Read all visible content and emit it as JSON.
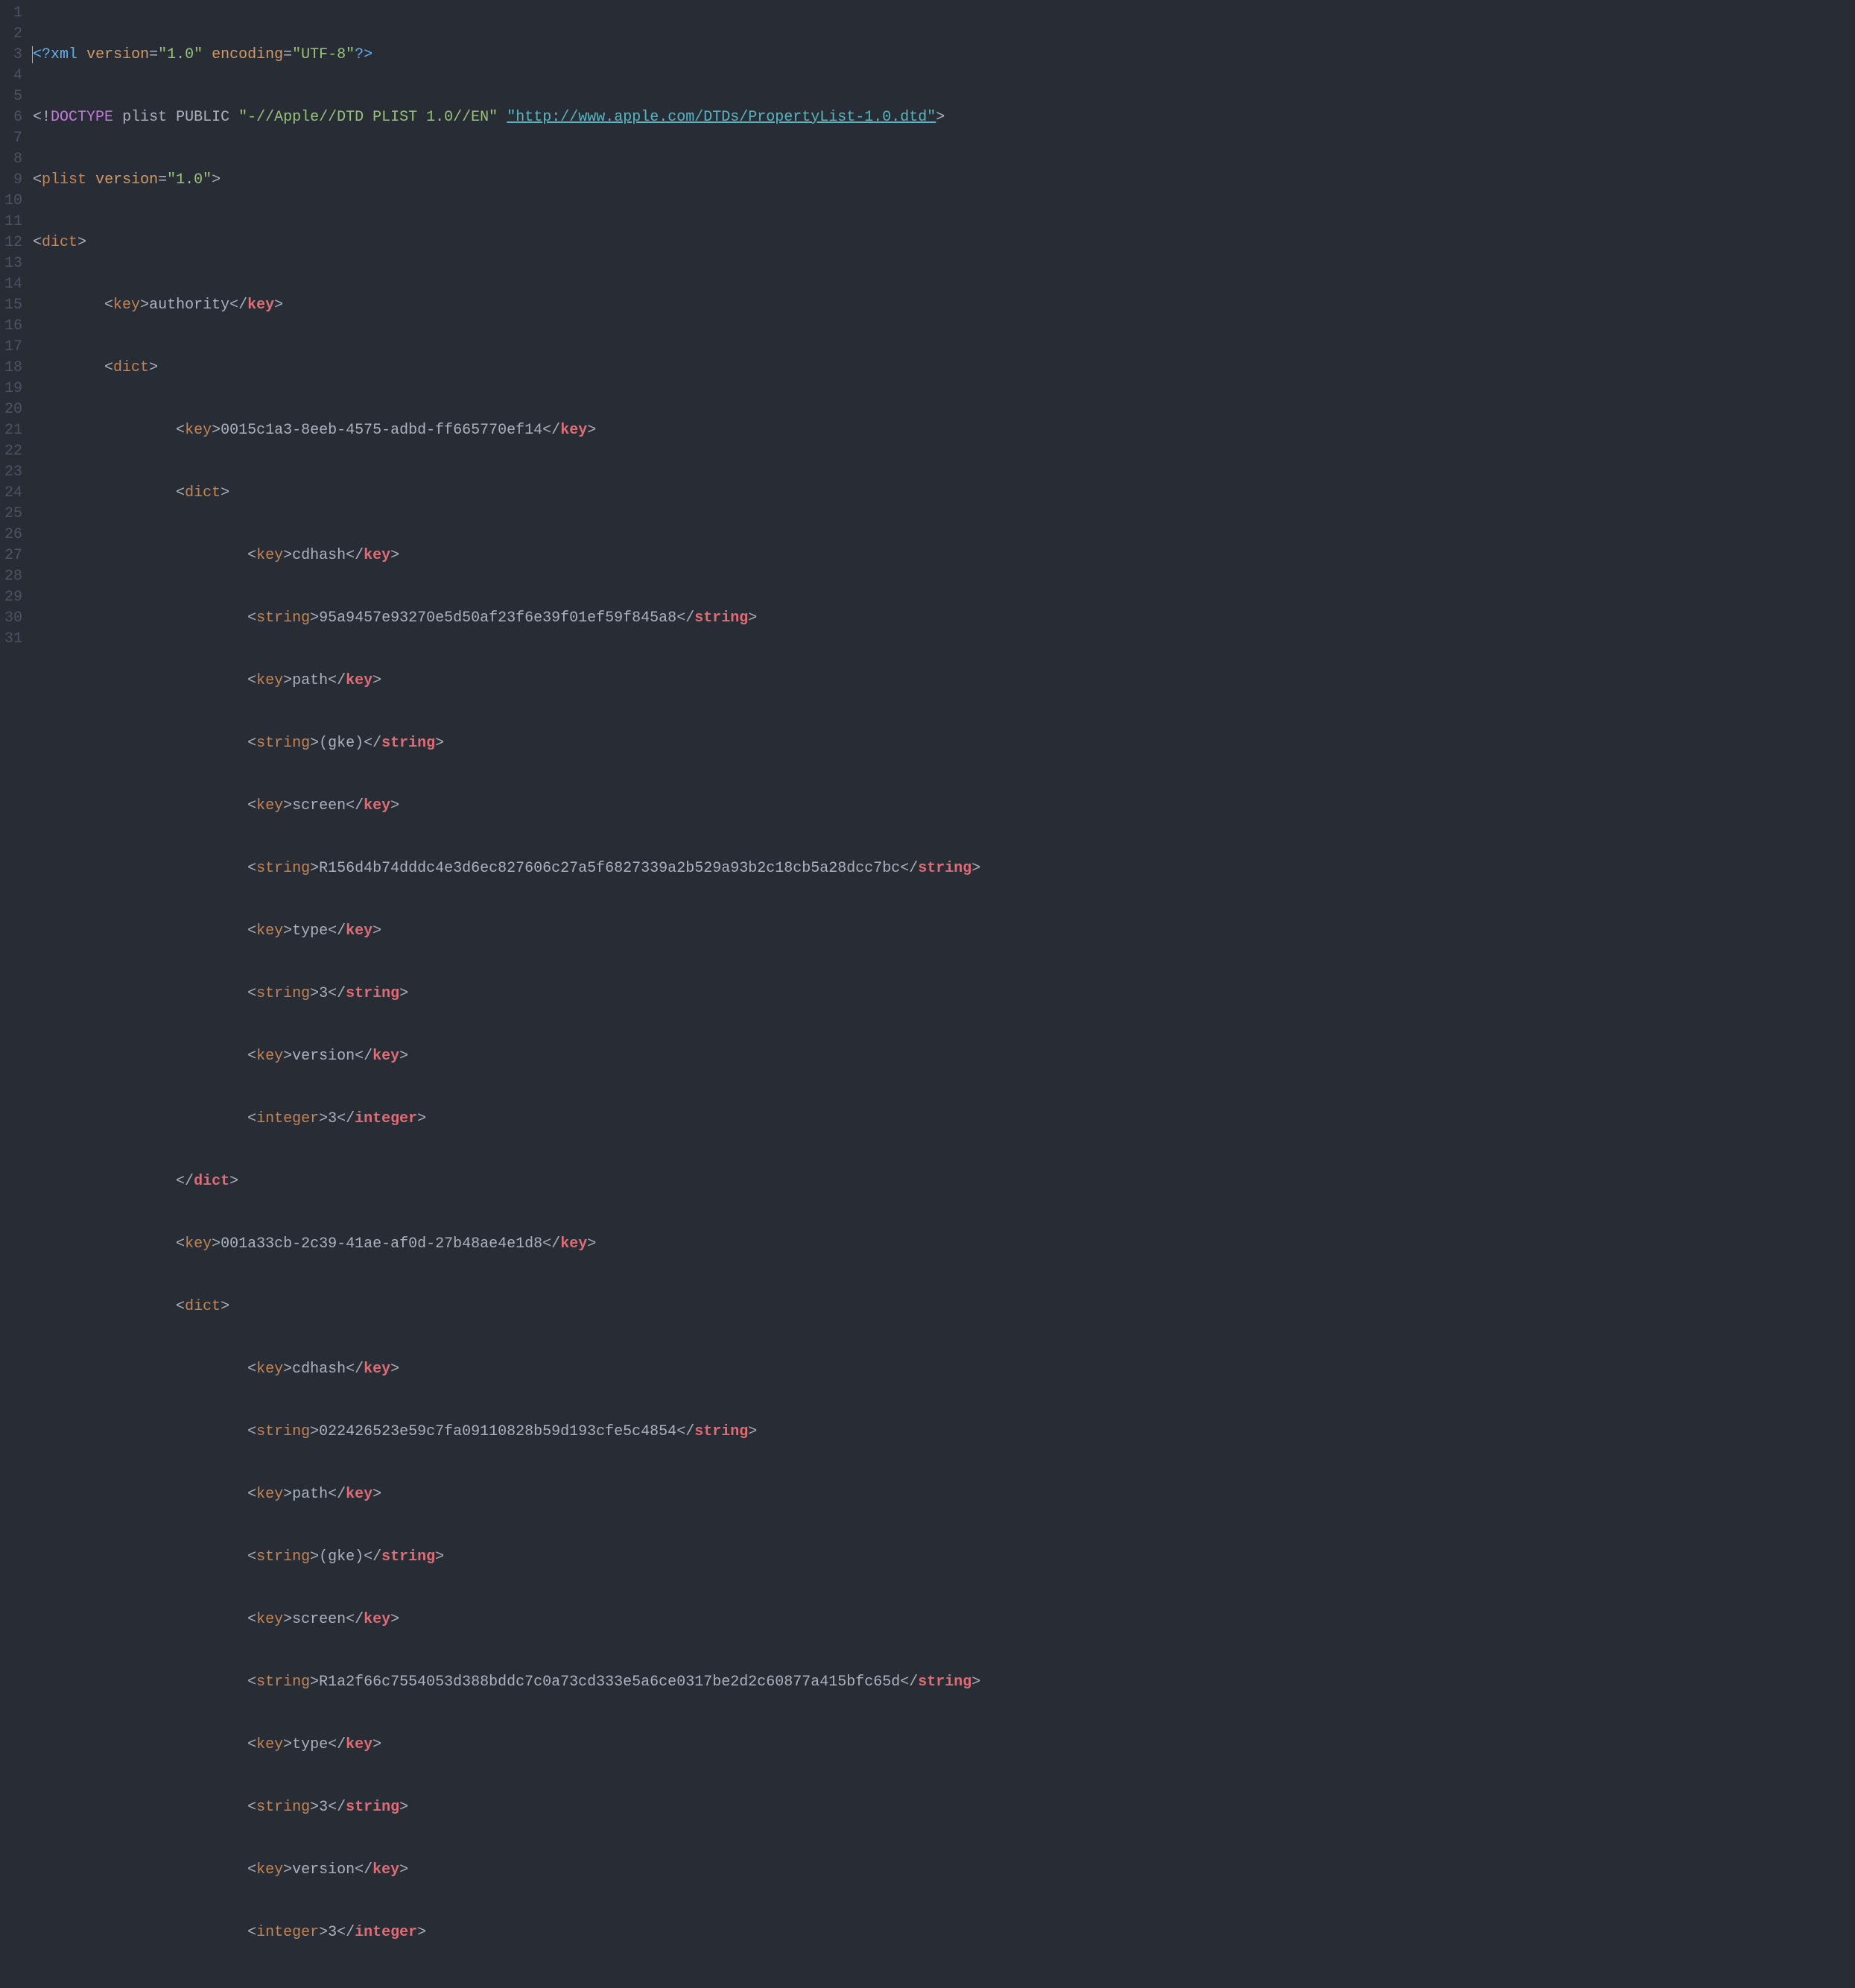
{
  "lines": [
    "1",
    "2",
    "3",
    "4",
    "5",
    "6",
    "7",
    "8",
    "9",
    "10",
    "11",
    "12",
    "13",
    "14",
    "15",
    "16",
    "17",
    "18",
    "19",
    "20",
    "21",
    "22",
    "23",
    "24",
    "25",
    "26",
    "27",
    "28",
    "29",
    "30",
    "31"
  ],
  "xml": {
    "decl_open": "<?",
    "decl_xml": "xml",
    "attr_version": "version",
    "version_val": "\"1.0\"",
    "attr_encoding": "encoding",
    "encoding_val": "\"UTF-8\"",
    "decl_close": "?>",
    "doctype_open": "<!",
    "doctype_kw": "DOCTYPE",
    "doctype_root": "plist",
    "doctype_pub": "PUBLIC",
    "doctype_fpi": "\"-//Apple//DTD PLIST 1.0//EN\"",
    "doctype_url": "\"http://www.apple.com/DTDs/PropertyList-1.0.dtd\"",
    "doctype_close": ">",
    "plist_tag": "plist",
    "plist_attr": "version",
    "plist_val": "\"1.0\"",
    "dict_tag": "dict",
    "key_tag": "key",
    "string_tag": "string",
    "integer_tag": "integer",
    "k_authority": "authority",
    "k_uuid1": "0015c1a3-8eeb-4575-adbd-ff665770ef14",
    "k_cdhash": "cdhash",
    "v_cdhash1": "95a9457e93270e5d50af23f6e39f01ef59f845a8",
    "k_path": "path",
    "v_path": "(gke)",
    "k_screen": "screen",
    "v_screen1": "R156d4b74dddc4e3d6ec827606c27a5f6827339a2b529a93b2c18cb5a28dcc7bc",
    "k_type": "type",
    "v_type": "3",
    "k_version": "version",
    "v_version": "3",
    "k_uuid2": "001a33cb-2c39-41ae-af0d-27b48ae4e1d8",
    "v_cdhash2": "022426523e59c7fa09110828b59d193cfe5c4854",
    "v_screen2": "R1a2f66c7554053d388bddc7c0a73cd333e5a6ce0317be2d2c60877a415bfc65d"
  },
  "indent": {
    "i0": "",
    "i1": "        ",
    "i2": "                ",
    "i3": "                        "
  },
  "sym": {
    "lt": "<",
    "gt": ">",
    "lts": "</",
    "eq": "=",
    "sp": " "
  }
}
